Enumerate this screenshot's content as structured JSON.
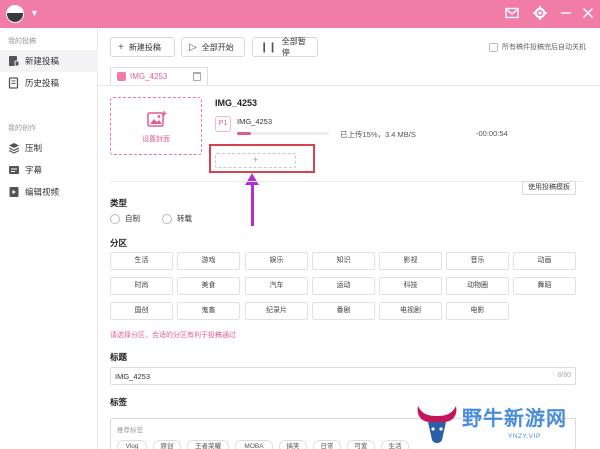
{
  "titlebar": {
    "bg": "#f17ca8",
    "icons": [
      "mail-icon",
      "gear-icon",
      "minimize-icon",
      "close-icon"
    ]
  },
  "sidebar": {
    "group1": "我的投稿",
    "items1": [
      {
        "label": "新建投稿",
        "icon": "upload-icon",
        "active": true
      },
      {
        "label": "历史投稿",
        "icon": "history-icon"
      }
    ],
    "group2": "我的创作",
    "items2": [
      {
        "label": "压制",
        "icon": "layers-icon"
      },
      {
        "label": "字幕",
        "icon": "subtitle-icon"
      },
      {
        "label": "编辑视频",
        "icon": "video-edit-icon"
      }
    ]
  },
  "toolbar": {
    "new": "新建投稿",
    "start_all": "全部开始",
    "pause_all": "全部暂停",
    "auto_shutdown": "所有稿件投稿完后自动关机"
  },
  "tab": {
    "label": "IMG_4253"
  },
  "upload": {
    "cover_label": "设置封面",
    "title": "IMG_4253",
    "part_badge": "P1",
    "part_name": "IMG_4253",
    "progress_pct": 15,
    "status": "已上传15%，3.4 MB/S",
    "remaining": "-00:00:54",
    "add_part": "+"
  },
  "template_button": "使用投稿模板",
  "type_section": {
    "label": "类型",
    "options": [
      "自制",
      "转载"
    ]
  },
  "category_section": {
    "label": "分区",
    "rows": [
      [
        "生活",
        "游戏",
        "娱乐",
        "知识",
        "影视",
        "音乐",
        "动画"
      ],
      [
        "时尚",
        "美食",
        "汽车",
        "运动",
        "科技",
        "动物圈",
        "舞蹈"
      ],
      [
        "国创",
        "鬼畜",
        "纪录片",
        "番剧",
        "电视剧",
        "电影"
      ]
    ],
    "hint": "请选择分区，合适的分区有利于投稿通过"
  },
  "title_section": {
    "label": "标题",
    "value": "IMG_4253",
    "count": "8/80"
  },
  "tag_section": {
    "label": "标签",
    "hint": "推荐标签",
    "tags": [
      "Vlog",
      "原创",
      "王者荣耀",
      "MOBA",
      "搞笑",
      "日常",
      "可爱",
      "生活"
    ]
  },
  "watermark": {
    "brand": "野牛新游网",
    "url": "YNZY.VIP"
  }
}
